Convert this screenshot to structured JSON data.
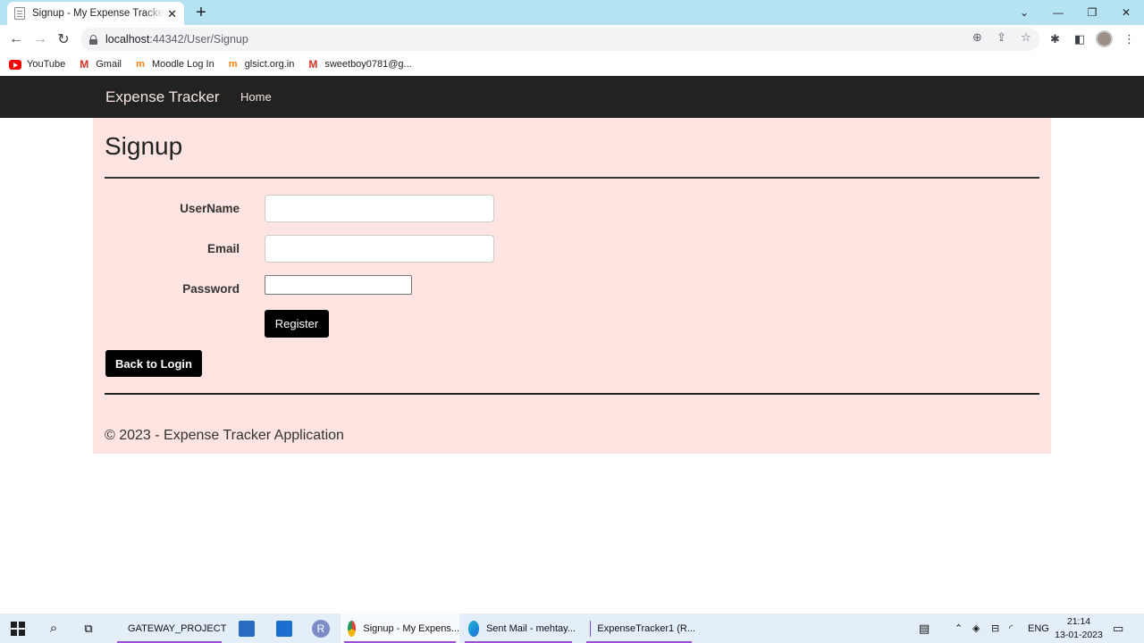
{
  "browser": {
    "tab_title": "Signup - My Expense Tracker App",
    "new_tab_label": "+",
    "address_host": "localhost",
    "address_path": ":44342/User/Signup",
    "bookmarks": [
      {
        "label": "YouTube",
        "icon": "youtube-icon"
      },
      {
        "label": "Gmail",
        "icon": "gmail-icon"
      },
      {
        "label": "Moodle Log In",
        "icon": "moodle-icon"
      },
      {
        "label": "glsict.org.in",
        "icon": "moodle-icon"
      },
      {
        "label": "sweetboy0781@g...",
        "icon": "gmail-icon"
      }
    ]
  },
  "site": {
    "brand": "Expense Tracker",
    "nav_home": "Home",
    "heading": "Signup",
    "fields": {
      "username_label": "UserName",
      "username_value": "",
      "email_label": "Email",
      "email_value": "",
      "password_label": "Password",
      "password_value": ""
    },
    "register_button": "Register",
    "back_button": "Back to Login",
    "footer": "© 2023 - Expense Tracker Application"
  },
  "taskbar": {
    "items": [
      {
        "label": "GATEWAY_PROJECT",
        "icon": "folder-icon"
      },
      {
        "label": "Signup - My Expens...",
        "icon": "chrome-icon"
      },
      {
        "label": "Sent Mail - mehtay...",
        "icon": "edge-icon"
      },
      {
        "label": "ExpenseTracker1 (R...",
        "icon": "visual-studio-icon"
      }
    ],
    "language": "ENG",
    "time": "21:14",
    "date": "13-01-2023"
  },
  "colors": {
    "navbar_bg": "#222222",
    "content_bg": "#ffe4e1",
    "button_bg": "#000000",
    "tabstrip_bg": "#b5e3f2"
  }
}
